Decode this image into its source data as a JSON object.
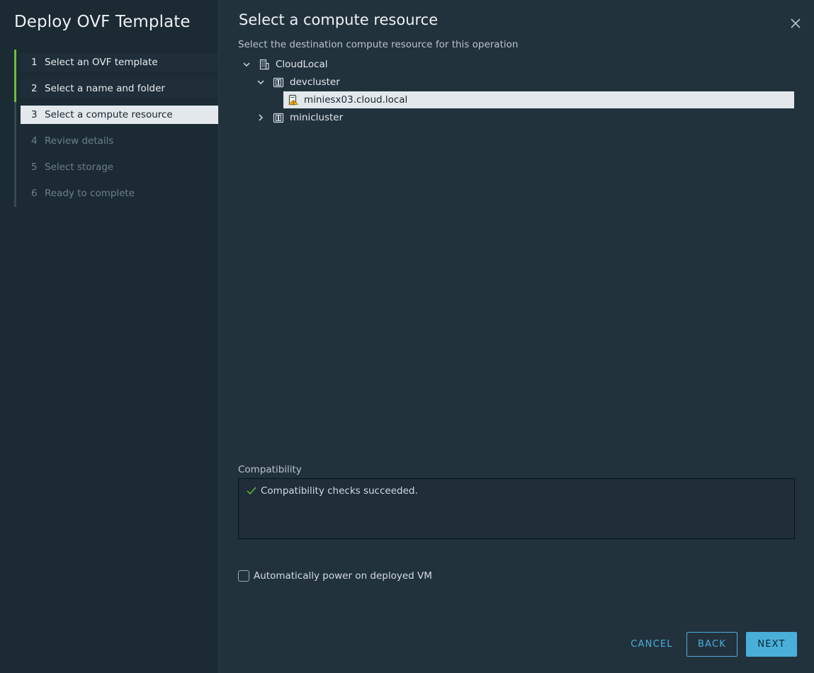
{
  "wizard": {
    "title": "Deploy OVF Template",
    "steps": [
      {
        "num": "1",
        "label": "Select an OVF template",
        "state": "done"
      },
      {
        "num": "2",
        "label": "Select a name and folder",
        "state": "done"
      },
      {
        "num": "3",
        "label": "Select a compute resource",
        "state": "current"
      },
      {
        "num": "4",
        "label": "Review details",
        "state": "pending"
      },
      {
        "num": "5",
        "label": "Select storage",
        "state": "pending"
      },
      {
        "num": "6",
        "label": "Ready to complete",
        "state": "pending"
      }
    ]
  },
  "main": {
    "title": "Select a compute resource",
    "subtitle": "Select the destination compute resource for this operation",
    "tree": {
      "datacenter": {
        "label": "CloudLocal",
        "icon": "datacenter-icon",
        "expanded": true
      },
      "cluster1": {
        "label": "devcluster",
        "icon": "cluster-icon",
        "expanded": true
      },
      "host": {
        "label": "miniesx03.cloud.local",
        "icon": "host-warning-icon",
        "selected": true
      },
      "cluster2": {
        "label": "minicluster",
        "icon": "cluster-icon",
        "expanded": false
      }
    },
    "compatibility": {
      "label": "Compatibility",
      "message": "Compatibility checks succeeded.",
      "status_color": "#6cbf3b"
    },
    "power_on": {
      "label": "Automatically power on deployed VM",
      "checked": false
    }
  },
  "footer": {
    "cancel_label": "CANCEL",
    "back_label": "BACK",
    "next_label": "NEXT"
  },
  "colors": {
    "accent": "#49afd9",
    "done_bar": "#6cbf3b",
    "sidebar_bg": "#1b2a33",
    "main_bg": "#22323d"
  }
}
